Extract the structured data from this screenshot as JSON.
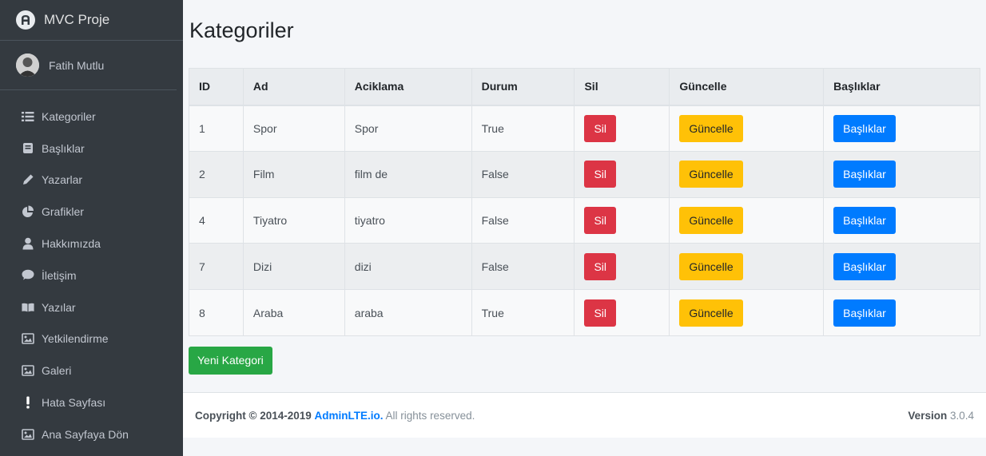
{
  "brand": {
    "name": "MVC Proje"
  },
  "user": {
    "name": "Fatih Mutlu"
  },
  "sidebar": {
    "items": [
      {
        "label": "Kategoriler",
        "icon": "list-icon"
      },
      {
        "label": "Başlıklar",
        "icon": "book-icon"
      },
      {
        "label": "Yazarlar",
        "icon": "pencil-icon"
      },
      {
        "label": "Grafikler",
        "icon": "pie-chart-icon"
      },
      {
        "label": "Hakkımızda",
        "icon": "user-icon"
      },
      {
        "label": "İletişim",
        "icon": "comment-icon"
      },
      {
        "label": "Yazılar",
        "icon": "open-book-icon"
      },
      {
        "label": "Yetkilendirme",
        "icon": "image-icon"
      },
      {
        "label": "Galeri",
        "icon": "image-icon"
      },
      {
        "label": "Hata Sayfası",
        "icon": "exclamation-icon"
      },
      {
        "label": "Ana Sayfaya Dön",
        "icon": "image-icon"
      }
    ]
  },
  "page": {
    "title": "Kategoriler"
  },
  "table": {
    "headers": [
      "ID",
      "Ad",
      "Aciklama",
      "Durum",
      "Sil",
      "Güncelle",
      "Başlıklar"
    ],
    "rows": [
      {
        "id": "1",
        "ad": "Spor",
        "aciklama": "Spor",
        "durum": "True"
      },
      {
        "id": "2",
        "ad": "Film",
        "aciklama": "film de",
        "durum": "False"
      },
      {
        "id": "4",
        "ad": "Tiyatro",
        "aciklama": "tiyatro",
        "durum": "False"
      },
      {
        "id": "7",
        "ad": "Dizi",
        "aciklama": "dizi",
        "durum": "False"
      },
      {
        "id": "8",
        "ad": "Araba",
        "aciklama": "araba",
        "durum": "True"
      }
    ],
    "delete_label": "Sil",
    "update_label": "Güncelle",
    "headings_label": "Başlıklar"
  },
  "actions": {
    "new_category_label": "Yeni Kategori"
  },
  "footer": {
    "copyright_prefix": "Copyright © 2014-2019",
    "link_text": "AdminLTE.io.",
    "rights": "All rights reserved.",
    "version_label": "Version",
    "version_value": "3.0.4"
  },
  "colors": {
    "sidebar_bg": "#343a40",
    "danger": "#dc3545",
    "warning": "#ffc107",
    "primary": "#007bff",
    "success": "#28a745"
  }
}
